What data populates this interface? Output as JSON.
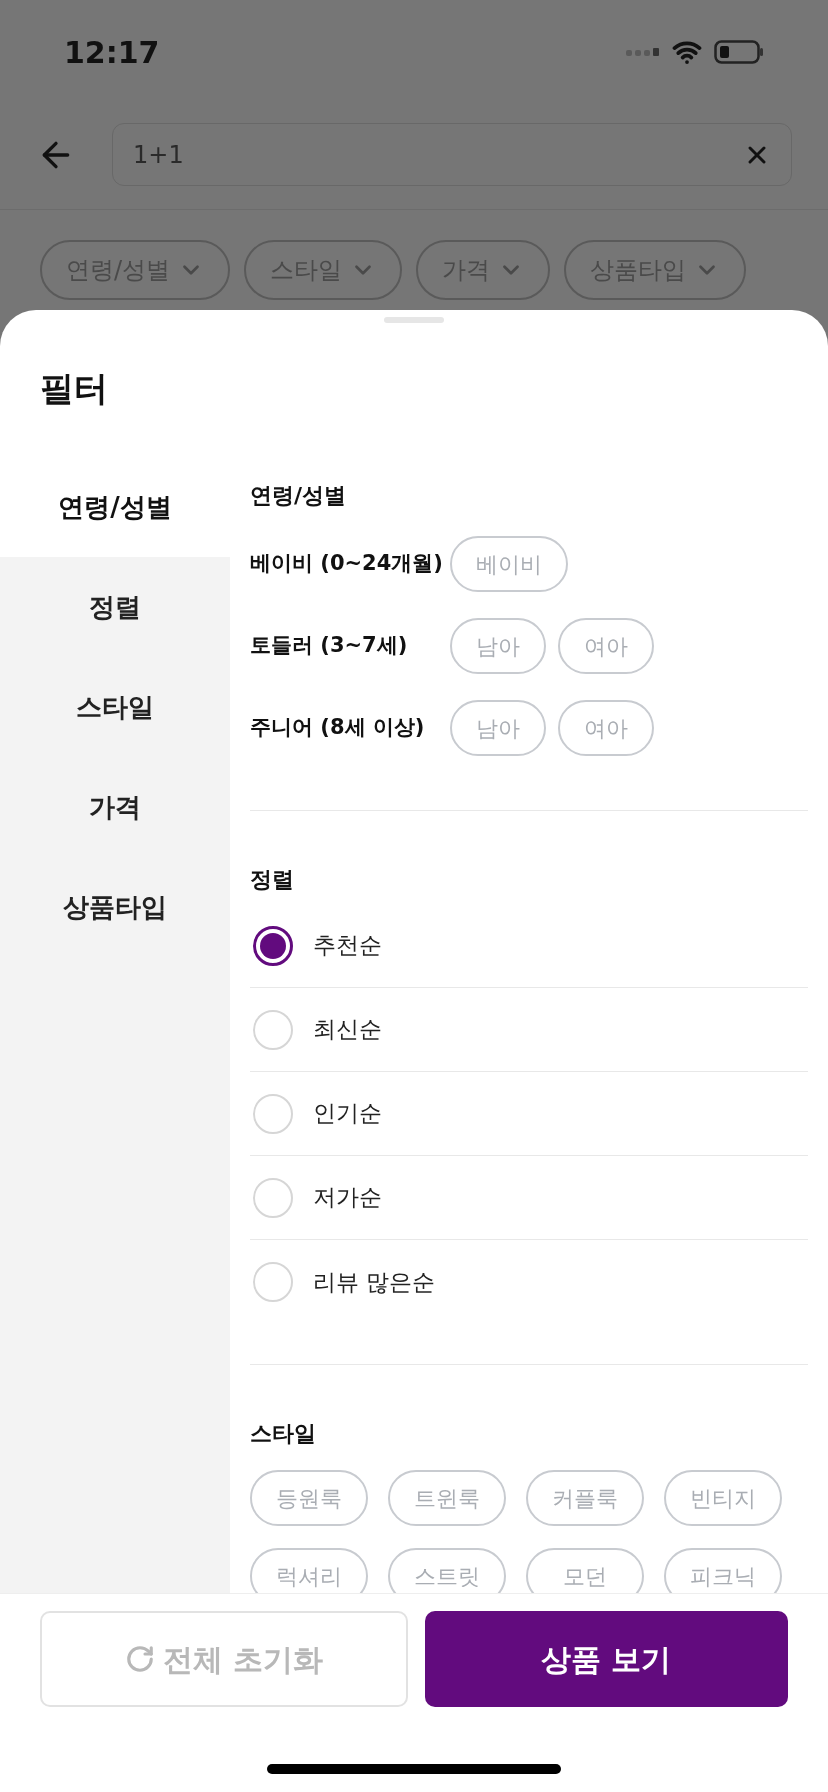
{
  "status_bar": {
    "time": "12:17"
  },
  "search": {
    "value": "1+1"
  },
  "filter_chips": [
    {
      "label": "연령/성별"
    },
    {
      "label": "스타일"
    },
    {
      "label": "가격"
    },
    {
      "label": "상품타입"
    }
  ],
  "sheet": {
    "title": "필터",
    "categories": [
      {
        "label": "연령/성별",
        "selected": true
      },
      {
        "label": "정렬",
        "selected": false
      },
      {
        "label": "스타일",
        "selected": false
      },
      {
        "label": "가격",
        "selected": false
      },
      {
        "label": "상품타입",
        "selected": false
      }
    ],
    "age_section": {
      "title": "연령/성별",
      "rows": [
        {
          "label": "베이비 (0~24개월)",
          "options": [
            {
              "label": "베이비",
              "selected": false
            }
          ]
        },
        {
          "label": "토들러 (3~7세)",
          "options": [
            {
              "label": "남아",
              "selected": false
            },
            {
              "label": "여아",
              "selected": false
            }
          ]
        },
        {
          "label": "주니어 (8세 이상)",
          "options": [
            {
              "label": "남아",
              "selected": false
            },
            {
              "label": "여아",
              "selected": false
            }
          ]
        }
      ]
    },
    "sort_section": {
      "title": "정렬",
      "options": [
        {
          "label": "추천순",
          "selected": true
        },
        {
          "label": "최신순",
          "selected": false
        },
        {
          "label": "인기순",
          "selected": false
        },
        {
          "label": "저가순",
          "selected": false
        },
        {
          "label": "리뷰 많은순",
          "selected": false
        }
      ]
    },
    "style_section": {
      "title": "스타일",
      "chips": [
        {
          "label": "등원룩",
          "selected": false
        },
        {
          "label": "트윈룩",
          "selected": false
        },
        {
          "label": "커플룩",
          "selected": false
        },
        {
          "label": "빈티지",
          "selected": false
        },
        {
          "label": "럭셔리",
          "selected": false
        },
        {
          "label": "스트릿",
          "selected": false
        },
        {
          "label": "모던",
          "selected": false
        },
        {
          "label": "피크닉",
          "selected": false
        }
      ]
    }
  },
  "reset_button": {
    "label": "전체 초기화",
    "disabled": true
  },
  "apply_button": {
    "label": "상품 보기"
  }
}
